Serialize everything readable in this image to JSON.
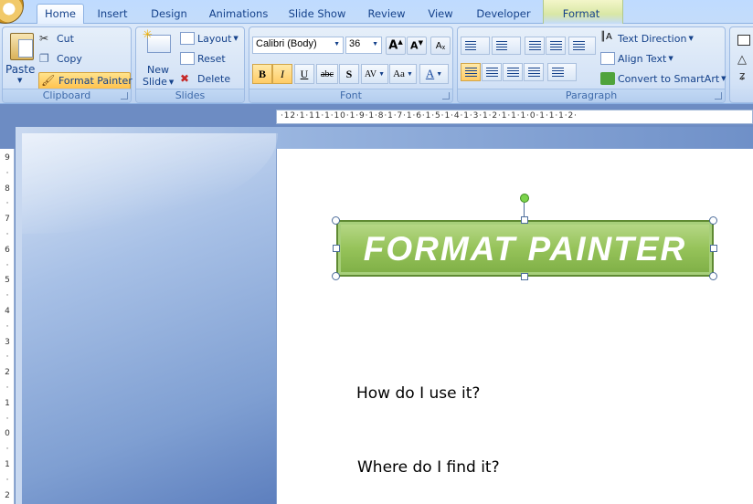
{
  "tabs": [
    "Home",
    "Insert",
    "Design",
    "Animations",
    "Slide Show",
    "Review",
    "View",
    "Developer",
    "Format"
  ],
  "active_tab": "Home",
  "clipboard": {
    "label": "Clipboard",
    "paste": "Paste",
    "cut": "Cut",
    "copy": "Copy",
    "format_painter": "Format Painter"
  },
  "slides": {
    "label": "Slides",
    "new_slide_line1": "New",
    "new_slide_line2": "Slide",
    "layout": "Layout",
    "reset": "Reset",
    "delete": "Delete"
  },
  "font": {
    "label": "Font",
    "family": "Calibri (Body)",
    "size": "36",
    "bold": "B",
    "italic": "I",
    "underline": "U",
    "strike": "abc",
    "shadow": "S",
    "spacing": "AV",
    "case": "Aa",
    "color": "A"
  },
  "paragraph": {
    "label": "Paragraph",
    "text_direction": "Text Direction",
    "align_text": "Align Text",
    "convert_smartart": "Convert to SmartArt"
  },
  "ruler": {
    "horizontal": "·12·1·11·1·10·1·9·1·8·1·7·1·6·1·5·1·4·1·3·1·2·1·1·1·0·1·1·1·2·",
    "vertical": [
      "9",
      "8",
      "7",
      "6",
      "5",
      "4",
      "3",
      "2",
      "1",
      "0",
      "1",
      "2"
    ]
  },
  "slide": {
    "title": "FORMAT PAINTER",
    "line1": "How do I use it?",
    "line2": "Where do I find it?"
  },
  "colors": {
    "title_box": "#96c35a",
    "ribbon": "#dbe8f9",
    "highlight": "#ffc04a"
  }
}
